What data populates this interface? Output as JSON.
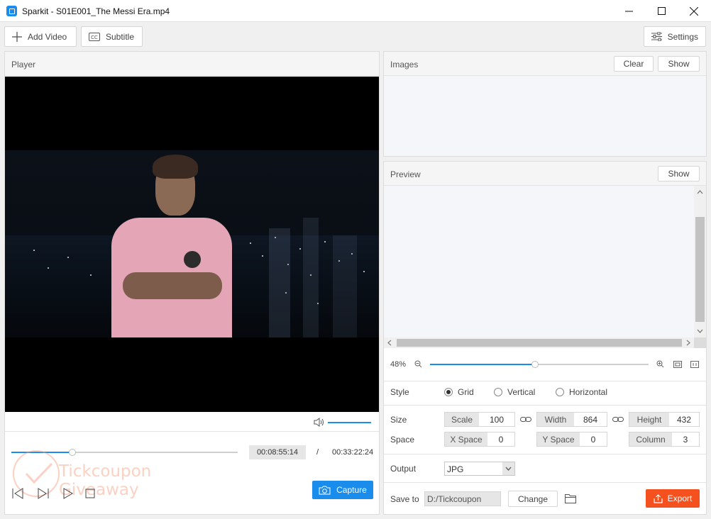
{
  "window": {
    "title": "Sparkit - S01E001_The Messi Era.mp4"
  },
  "toolbar": {
    "add_video": "Add Video",
    "subtitle": "Subtitle",
    "settings": "Settings"
  },
  "player": {
    "title": "Player",
    "volume_level": 1.0,
    "progress": 0.27,
    "current_time": "00:08:55:14",
    "separator": "/",
    "total_time": "00:33:22:24",
    "capture_label": "Capture"
  },
  "images": {
    "title": "Images",
    "clear_label": "Clear",
    "show_label": "Show"
  },
  "preview": {
    "title": "Preview",
    "show_label": "Show",
    "zoom_percent": "48%",
    "zoom_level": 0.48
  },
  "settings": {
    "style_label": "Style",
    "style_options": [
      "Grid",
      "Vertical",
      "Horizontal"
    ],
    "style_selected": "Grid",
    "size_label": "Size",
    "space_label": "Space",
    "scale_label": "Scale",
    "scale_value": "100",
    "width_label": "Width",
    "width_value": "864",
    "height_label": "Height",
    "height_value": "432",
    "xspace_label": "X Space",
    "xspace_value": "0",
    "yspace_label": "Y Space",
    "yspace_value": "0",
    "column_label": "Column",
    "column_value": "3",
    "output_label": "Output",
    "output_value": "JPG",
    "save_to_label": "Save to",
    "save_path": "D:/Tickcoupon",
    "change_label": "Change",
    "export_label": "Export"
  },
  "watermark": {
    "line1": "Tickcoupon",
    "line2": "Giveaway"
  },
  "colors": {
    "accent": "#1a8ceb",
    "export": "#f4511e"
  }
}
